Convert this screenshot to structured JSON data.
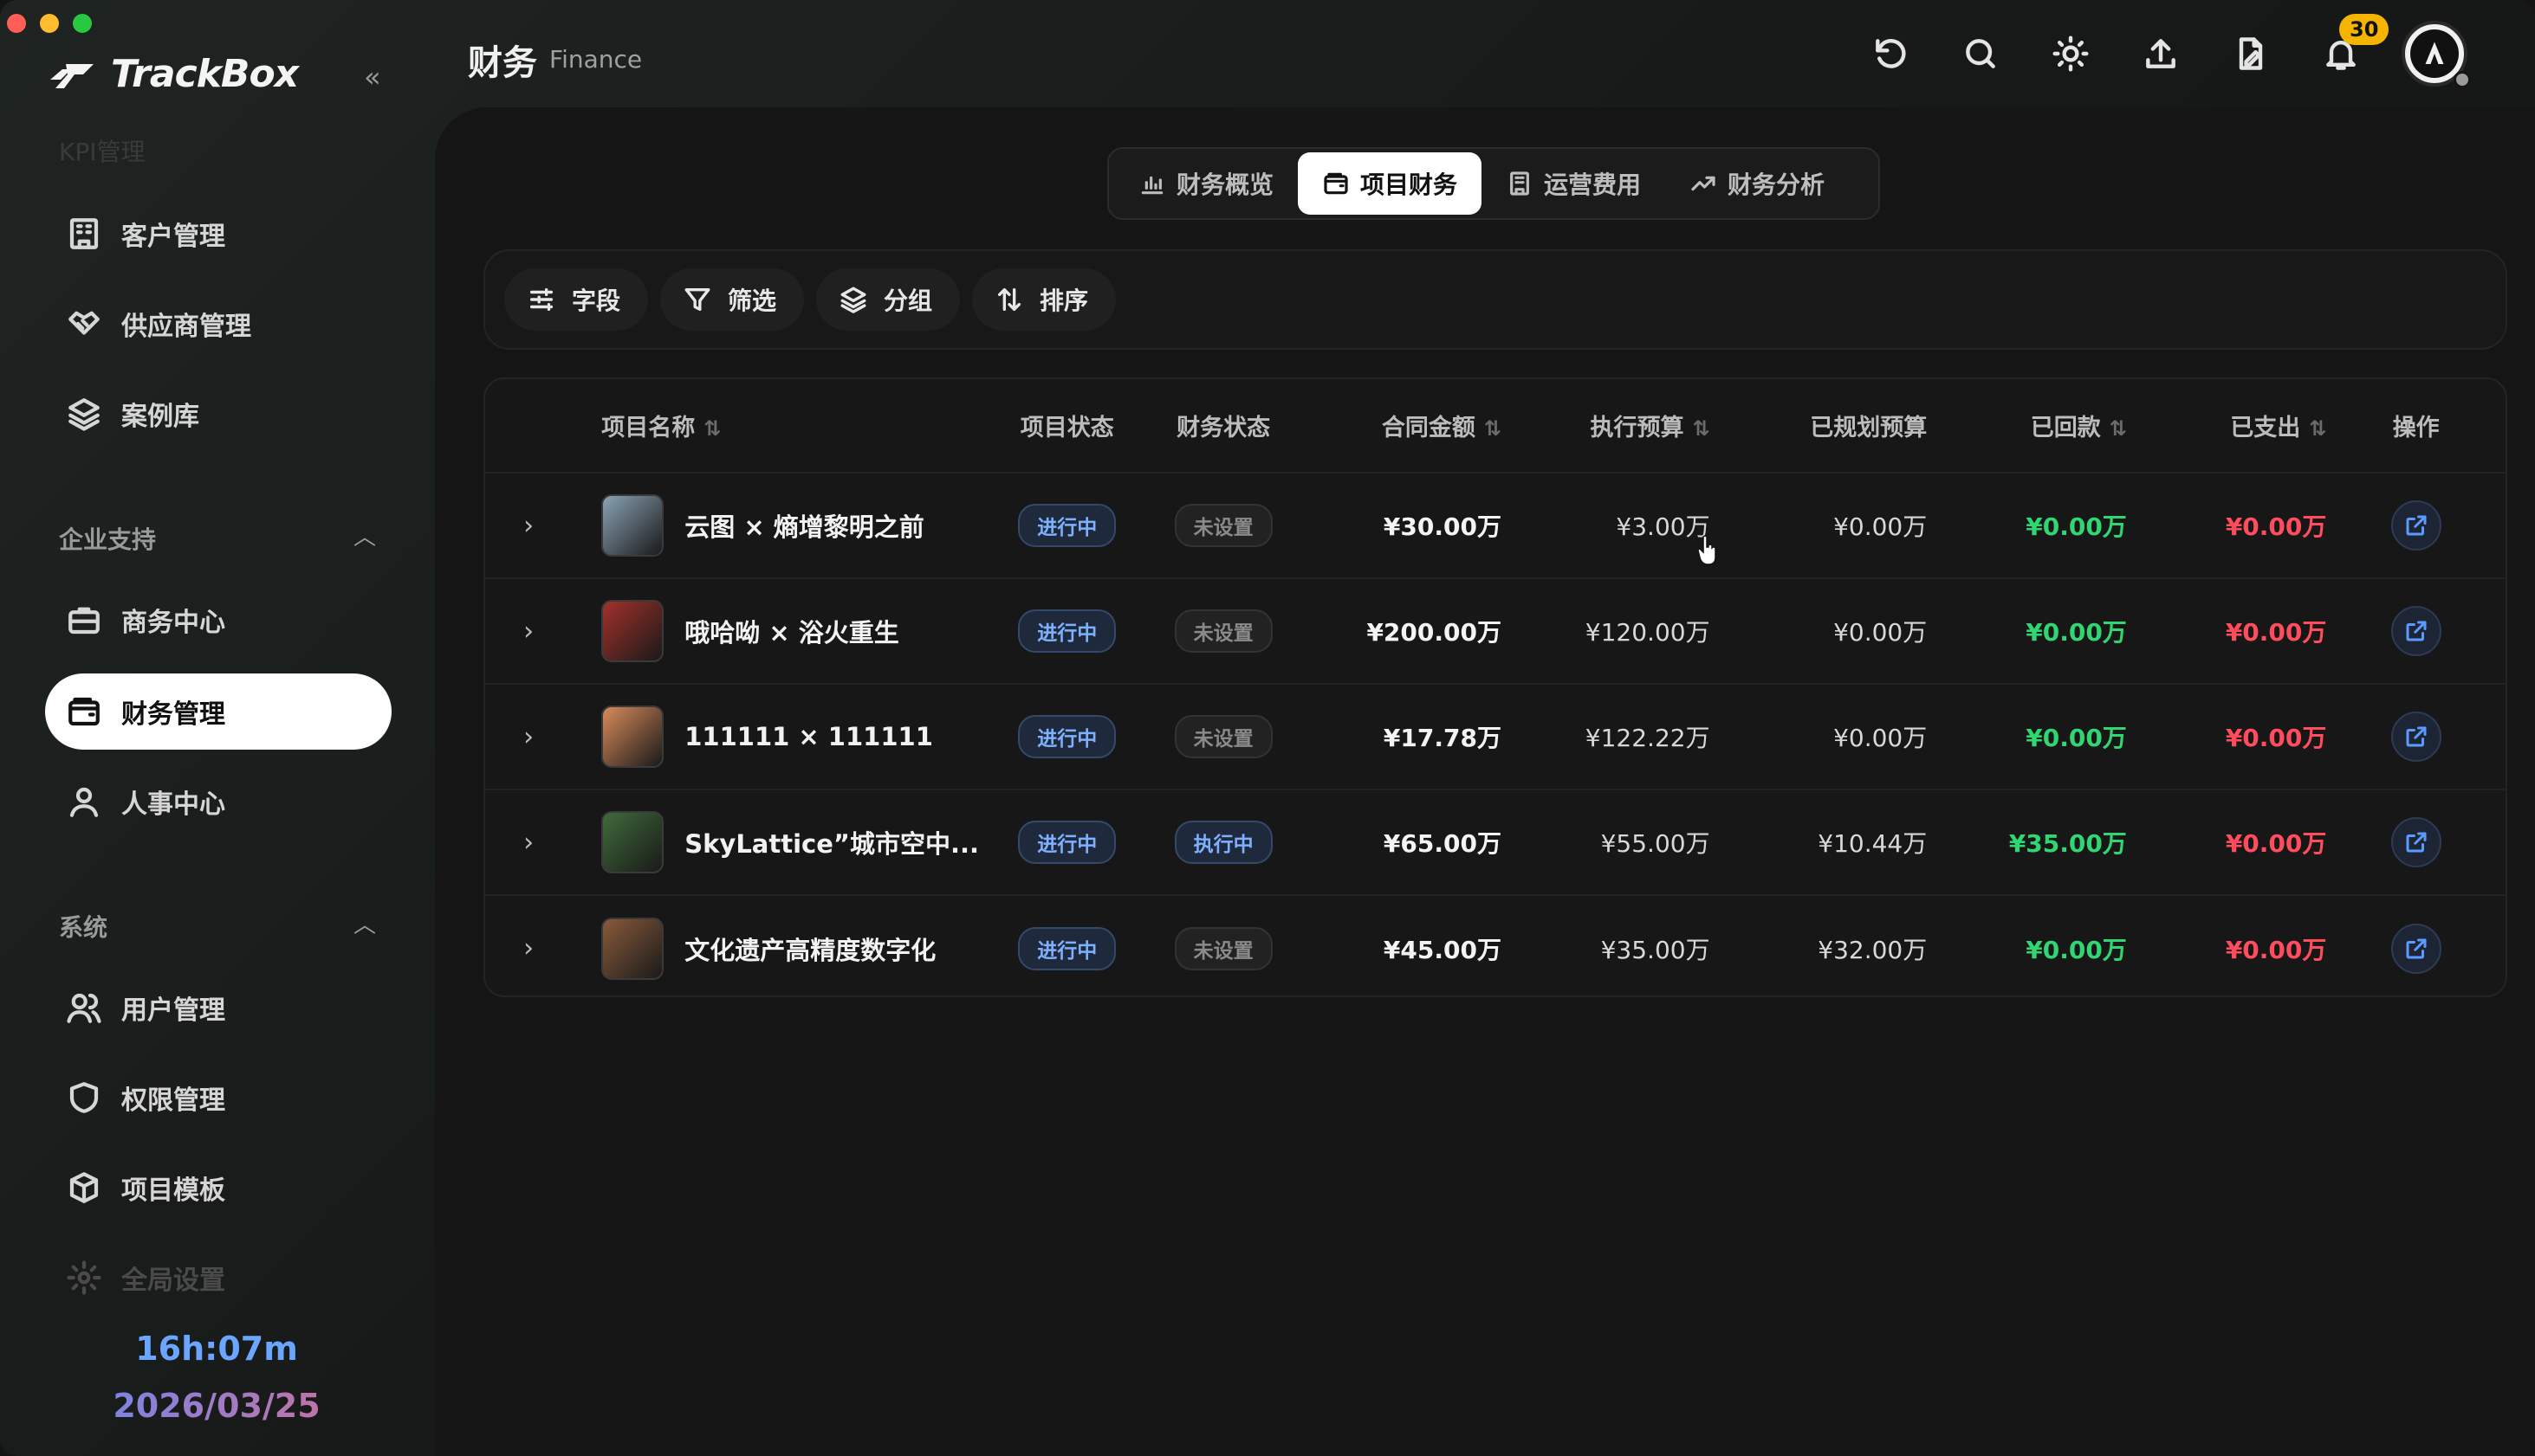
{
  "window": {
    "traffic_colors": [
      "#ff5f57",
      "#febc2e",
      "#28c840"
    ]
  },
  "sidebar": {
    "brand": "TrackBox",
    "ghost_section": "KPI管理",
    "items": [
      {
        "label": "客户管理",
        "icon": "building-icon"
      },
      {
        "label": "供应商管理",
        "icon": "handshake-icon"
      },
      {
        "label": "案例库",
        "icon": "layers-icon"
      }
    ],
    "groups": {
      "enterprise": {
        "label": "企业支持"
      },
      "system": {
        "label": "系统"
      }
    },
    "enterprise_items": [
      {
        "label": "商务中心",
        "icon": "briefcase-icon"
      },
      {
        "label": "财务管理",
        "icon": "wallet-icon",
        "active": true
      },
      {
        "label": "人事中心",
        "icon": "user-icon"
      }
    ],
    "system_items": [
      {
        "label": "用户管理",
        "icon": "users-icon"
      },
      {
        "label": "权限管理",
        "icon": "shield-icon"
      },
      {
        "label": "项目模板",
        "icon": "box-icon"
      },
      {
        "label": "全局设置",
        "icon": "gear-icon"
      }
    ],
    "timer": "16h:07m",
    "date": "2026/03/25"
  },
  "header": {
    "title": "财务",
    "subtitle": "Finance",
    "notification_count": "30",
    "icons": [
      "refresh-icon",
      "search-icon",
      "sun-icon",
      "upload-icon",
      "document-sign-icon",
      "bell-icon"
    ]
  },
  "tabs": [
    {
      "label": "财务概览",
      "icon": "bar-chart-icon"
    },
    {
      "label": "项目财务",
      "icon": "wallet-icon",
      "active": true
    },
    {
      "label": "运营费用",
      "icon": "building-icon"
    },
    {
      "label": "财务分析",
      "icon": "trend-icon"
    }
  ],
  "toolbar": {
    "fields": "字段",
    "filter": "筛选",
    "group": "分组",
    "sort": "排序"
  },
  "table": {
    "columns": {
      "name": "项目名称",
      "status": "项目状态",
      "fin_status": "财务状态",
      "contract": "合同金额",
      "exec_budget": "执行预算",
      "planned_budget": "已规划预算",
      "received": "已回款",
      "spent": "已支出",
      "action": "操作"
    },
    "rows": [
      {
        "name": "云图 × 熵增黎明之前",
        "status": "进行中",
        "fin_status": "未设置",
        "fin_tone": "gray",
        "contract": "¥30.00万",
        "exec_budget": "¥3.00万",
        "planned_budget": "¥0.00万",
        "received": "¥0.00万",
        "spent": "¥0.00万",
        "thumb": "#8aa3b5"
      },
      {
        "name": "哦哈呦 × 浴火重生",
        "status": "进行中",
        "fin_status": "未设置",
        "fin_tone": "gray",
        "contract": "¥200.00万",
        "exec_budget": "¥120.00万",
        "planned_budget": "¥0.00万",
        "received": "¥0.00万",
        "spent": "¥0.00万",
        "thumb": "#a3302a"
      },
      {
        "name": "111111 × 111111",
        "status": "进行中",
        "fin_status": "未设置",
        "fin_tone": "gray",
        "contract": "¥17.78万",
        "exec_budget": "¥122.22万",
        "planned_budget": "¥0.00万",
        "received": "¥0.00万",
        "spent": "¥0.00万",
        "thumb": "#d88a5a"
      },
      {
        "name": "SkyLattice”城市空中...",
        "status": "进行中",
        "fin_status": "执行中",
        "fin_tone": "blue",
        "contract": "¥65.00万",
        "exec_budget": "¥55.00万",
        "planned_budget": "¥10.44万",
        "received": "¥35.00万",
        "spent": "¥0.00万",
        "thumb": "#3f6b3a"
      },
      {
        "name": "文化遗产高精度数字化",
        "status": "进行中",
        "fin_status": "未设置",
        "fin_tone": "gray",
        "contract": "¥45.00万",
        "exec_budget": "¥35.00万",
        "planned_budget": "¥32.00万",
        "received": "¥0.00万",
        "spent": "¥0.00万",
        "thumb": "#8a5a3a"
      }
    ]
  }
}
